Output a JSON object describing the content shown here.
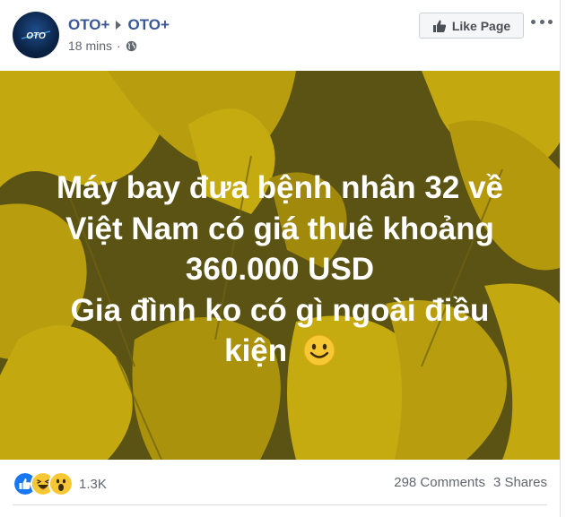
{
  "header": {
    "page_name": "OTO+",
    "page_name_2": "OTO+",
    "timestamp": "18 mins",
    "separator": "·",
    "avatar_logo_text": "OTO",
    "like_page_label": "Like Page"
  },
  "post": {
    "lines": [
      "Máy bay đưa bệnh nhân 32 về",
      "Việt Nam có giá thuê khoảng",
      "360.000 USD",
      "Gia đình ko có gì ngoài điều",
      "kiện"
    ],
    "background_colors": {
      "dark": "#5b5314",
      "light": "#c3a80f"
    }
  },
  "footer": {
    "reaction_icons": [
      "like-icon",
      "haha-icon",
      "wow-icon"
    ],
    "reaction_count": "1.3K",
    "comments": "298 Comments",
    "shares": "3 Shares"
  },
  "colors": {
    "link": "#385898",
    "meta": "#606770",
    "like_blue": "#1877f2"
  }
}
